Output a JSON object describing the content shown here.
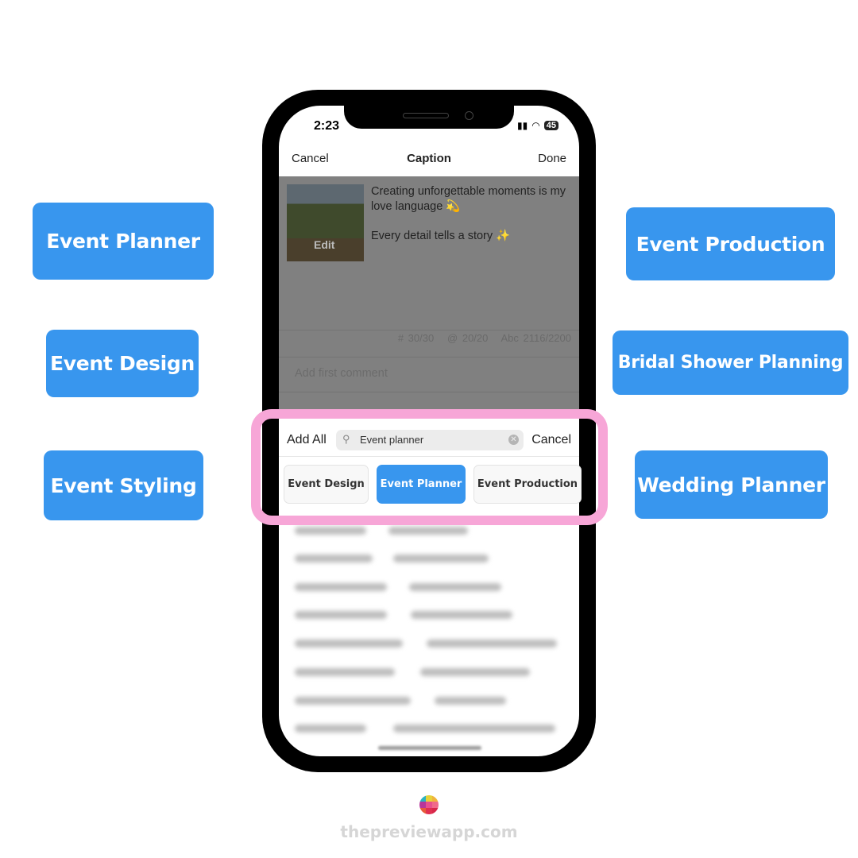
{
  "tags_left": [
    "Event Planner",
    "Event Design",
    "Event Styling"
  ],
  "tags_right": [
    "Event Production",
    "Bridal Shower Planning",
    "Wedding Planner"
  ],
  "status": {
    "time": "2:23",
    "battery": "45"
  },
  "nav": {
    "cancel": "Cancel",
    "title": "Caption",
    "done": "Done"
  },
  "caption": {
    "line1": "Creating unforgettable moments is my love language 💫",
    "line2": "Every detail tells a story ✨",
    "edit_label": "Edit"
  },
  "counts": {
    "hashtags": "# 30/30",
    "mentions": "@ 20/20",
    "chars": "Abc 2116/2200"
  },
  "comment_placeholder": "Add first comment",
  "search": {
    "add_all": "Add All",
    "value": "Event planner",
    "cancel": "Cancel"
  },
  "chips": [
    {
      "label": "Event Design",
      "selected": false
    },
    {
      "label": "Event Planner",
      "selected": true
    },
    {
      "label": "Event Production",
      "selected": false
    }
  ],
  "colors": {
    "accent": "#3896ee",
    "highlight": "#f7a6d7"
  },
  "footer": "thepreviewapp.com"
}
